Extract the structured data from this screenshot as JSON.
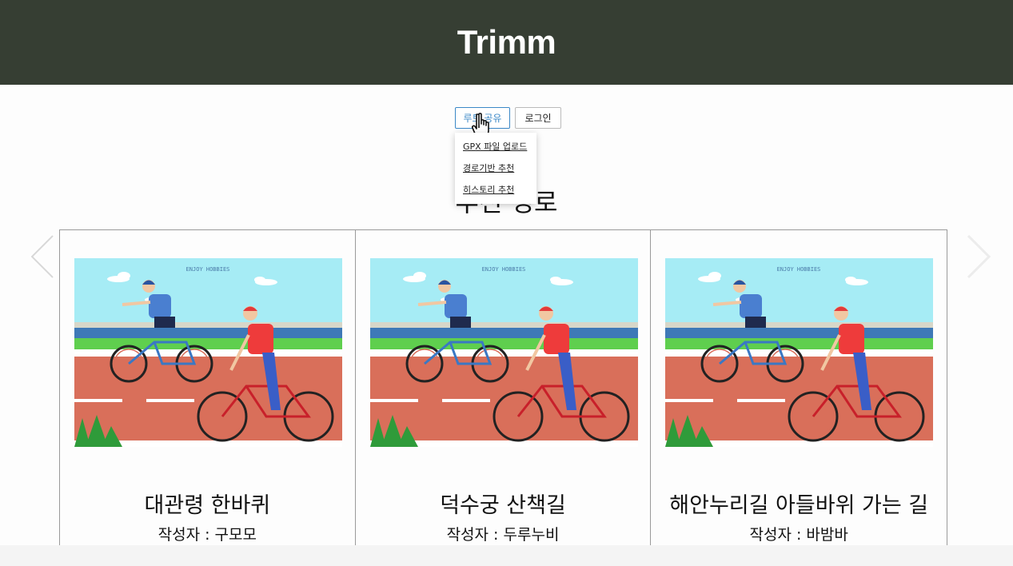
{
  "app": {
    "title": "Trimm"
  },
  "nav": {
    "share_label": "루트 공유",
    "login_label": "로그인"
  },
  "dropdown": {
    "items": [
      "GPX 파일 업로드",
      "경로기반 추천",
      "히스토리 추천"
    ]
  },
  "section": {
    "title": "추천 경로"
  },
  "image": {
    "banner_text": "ENJOY HOBBIES"
  },
  "cards": [
    {
      "name": "대관령 한바퀴",
      "author": "작성자 : 구모모"
    },
    {
      "name": "덕수궁 산책길",
      "author": "작성자 : 두루누비"
    },
    {
      "name": "해안누리길 아들바위 가는 길",
      "author": "작성자 : 바밤바"
    }
  ],
  "colors": {
    "header_bg": "#363e33",
    "accent": "#3b88c7",
    "road": "#d96f5a",
    "sky": "#a6ecf5"
  }
}
